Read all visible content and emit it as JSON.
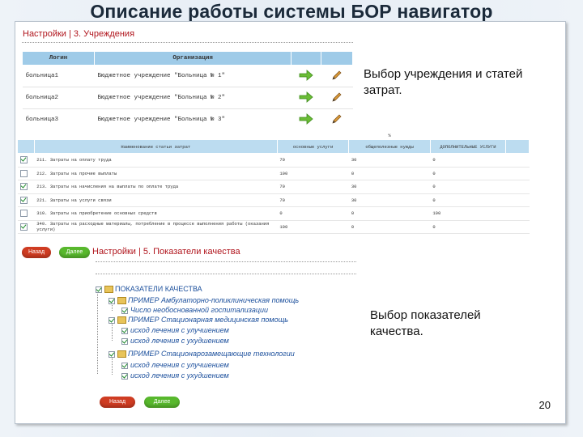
{
  "slide": {
    "title": "Описание работы системы БОР навигатор",
    "page_number": "20"
  },
  "panel1": {
    "breadcrumb": "Настройки | 3. Учреждения",
    "columns": [
      "Логин",
      "Организация",
      "",
      ""
    ],
    "rows": [
      {
        "login": "больница1",
        "org": "Бюджетное учреждение \"Больница № 1\"",
        "action_icon": "arrow-right-icon",
        "edit_icon": "pencil-icon"
      },
      {
        "login": "больница2",
        "org": "Бюджетное учреждение \"Больница № 2\"",
        "action_icon": "arrow-right-icon",
        "edit_icon": "pencil-icon"
      },
      {
        "login": "больница3",
        "org": "Бюджетное учреждение \"Больница № 3\"",
        "action_icon": "arrow-right-icon",
        "edit_icon": "pencil-icon"
      }
    ],
    "callout": "Выбор учреждения и статей затрат."
  },
  "panel2": {
    "pct_header": "%",
    "columns": [
      "",
      "Наименование статьи затрат",
      "основные услуги",
      "общеполезные нужды",
      "ДОПОЛНИТЕЛЬНЫЕ УСЛУГИ",
      ""
    ],
    "rows": [
      {
        "checked": true,
        "name": "211. Затраты на оплату труда",
        "v1": "70",
        "v2": "30",
        "v3": "0"
      },
      {
        "checked": false,
        "name": "212. Затраты на прочие выплаты",
        "v1": "100",
        "v2": "0",
        "v3": "0"
      },
      {
        "checked": true,
        "name": "213. Затраты на начисления на выплаты по оплате труда",
        "v1": "70",
        "v2": "30",
        "v3": "0"
      },
      {
        "checked": true,
        "name": "221. Затраты на услуги связи",
        "v1": "70",
        "v2": "30",
        "v3": "0"
      },
      {
        "checked": false,
        "name": "310. Затраты на приобретение основных средств",
        "v1": "0",
        "v2": "0",
        "v3": "100"
      },
      {
        "checked": true,
        "name": "340. Затраты на расходные материалы, потребление в процессе выполнения работы (оказания услуги)",
        "v1": "100",
        "v2": "0",
        "v3": "0"
      }
    ],
    "back_label": "Назад",
    "next_label": "Далее"
  },
  "panel3": {
    "breadcrumb": "Настройки | 5. Показатели качества",
    "tree": {
      "root": "ПОКАЗАТЕЛИ КАЧЕСТВА",
      "n1": "ПРИМЕР Амбулаторно-поликлиническая помощь",
      "n1a": "Число необоснованной госпитализации",
      "n2": "ПРИМЕР Стационарная медицинская помощь",
      "n2a": "исход лечения с улучшением",
      "n2b": "исход лечения с ухудшением",
      "n3": "ПРИМЕР Стационарозамещающие технологии",
      "n3a": "исход лечения с улучшением",
      "n3b": "исход лечения с ухудшением"
    },
    "callout": "Выбор показателей качества.",
    "back_label": "Назад",
    "next_label": "Далее"
  }
}
